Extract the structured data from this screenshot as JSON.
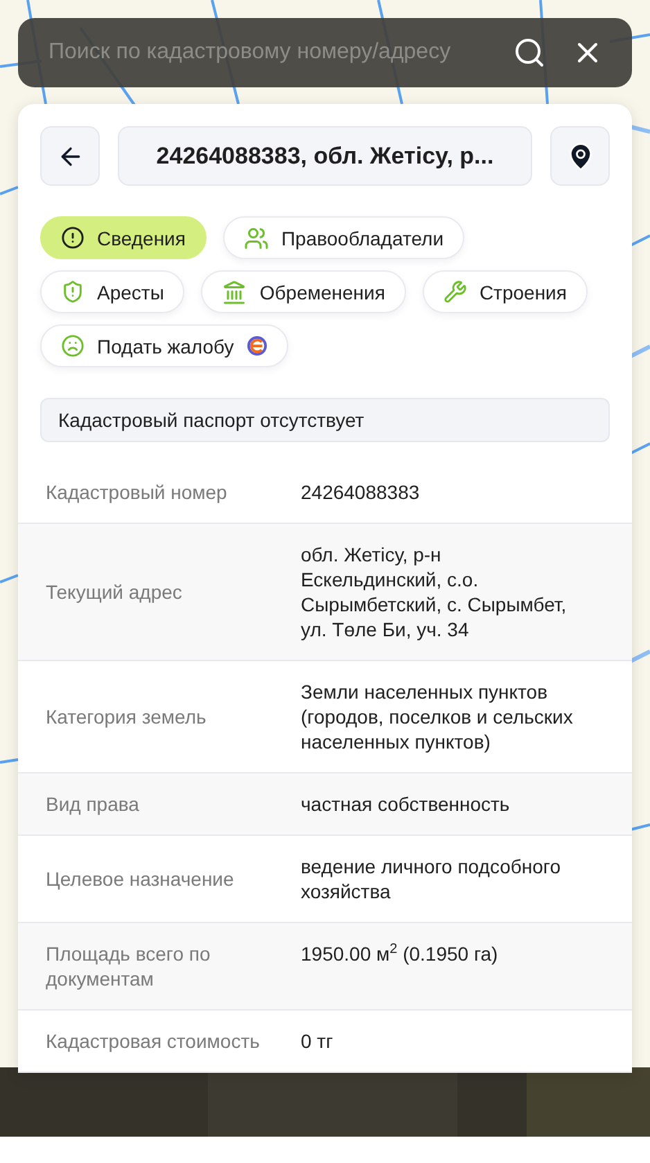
{
  "search": {
    "placeholder": "Поиск по кадастровому номеру/адресу"
  },
  "header": {
    "title": "24264088383, обл. Жетісу, р..."
  },
  "tabs": [
    {
      "label": "Сведения",
      "kind": "info",
      "selected": true
    },
    {
      "label": "Правообладатели",
      "kind": "owners",
      "selected": false
    },
    {
      "label": "Аресты",
      "kind": "arrests",
      "selected": false
    },
    {
      "label": "Обременения",
      "kind": "encumbrances",
      "selected": false
    },
    {
      "label": "Строения",
      "kind": "buildings",
      "selected": false
    },
    {
      "label": "Подать жалобу",
      "kind": "complaint",
      "selected": false
    }
  ],
  "notice": "Кадастровый паспорт отсутствует",
  "rows": [
    {
      "label": "Кадастровый номер",
      "value": "24264088383"
    },
    {
      "label": "Текущий адрес",
      "value": "обл. Жетісу, р-н Ескельдинский, с.о. Сырымбетский, с. Сырымбет, ул. Төле Би, уч. 34"
    },
    {
      "label": "Категория земель",
      "value": "Земли населенных пунктов (городов, поселков и сельских населенных пунктов)"
    },
    {
      "label": "Вид права",
      "value": "частная собственность"
    },
    {
      "label": "Целевое назначение",
      "value": "ведение личного подсобного хозяйства"
    },
    {
      "label": "Площадь всего по документам",
      "value": "1950.00 м$^{2}$ (0.1950 га)"
    },
    {
      "label": "Кадастровая стоимость",
      "value": "0 тг"
    }
  ]
}
